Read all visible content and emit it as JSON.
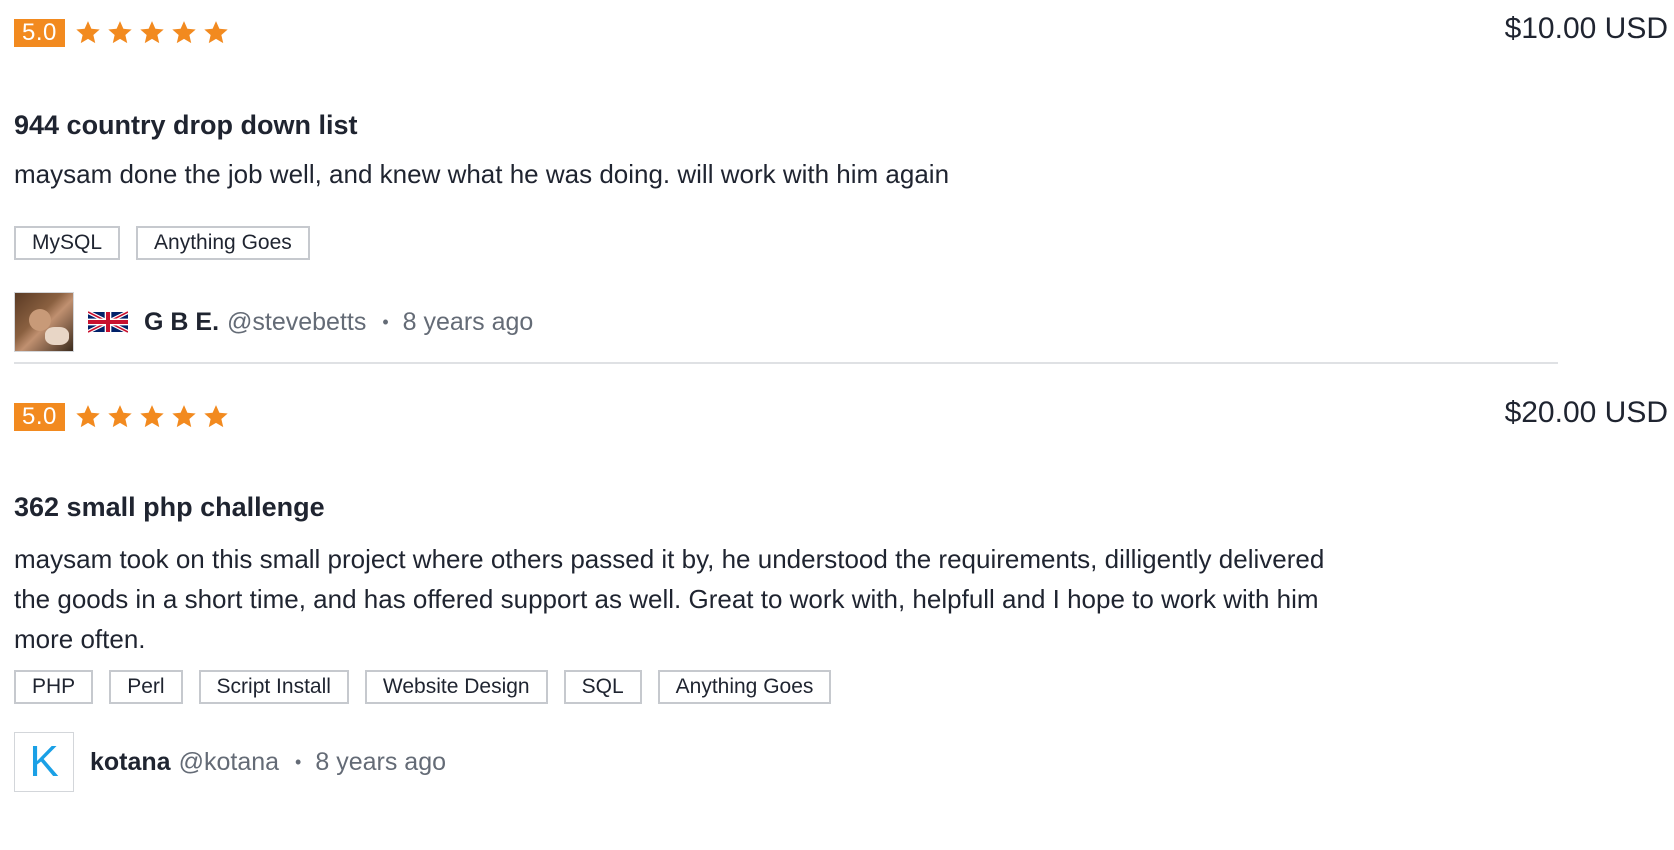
{
  "reviews": [
    {
      "rating": "5.0",
      "stars": 5,
      "price": "$10.00 USD",
      "title": "944 country drop down list",
      "text": "maysam done the job well, and knew what he was doing. will work with him again",
      "tags": [
        "MySQL",
        "Anything Goes"
      ],
      "author_name": "G B E.",
      "author_handle": "@stevebetts",
      "separator": "•",
      "time_ago": "8 years ago",
      "country_flag": "united-kingdom-flag-icon"
    },
    {
      "rating": "5.0",
      "stars": 5,
      "price": "$20.00 USD",
      "title": "362 small php challenge",
      "text": "maysam took on this small project where others passed it by, he understood the requirements, dilligently delivered the goods in a short time, and has offered support as well. Great to work with, helpfull and I hope to work with him more often.",
      "tags": [
        "PHP",
        "Perl",
        "Script Install",
        "Website Design",
        "SQL",
        "Anything Goes"
      ],
      "author_name": "kotana",
      "author_handle": "@kotana",
      "separator": "•",
      "time_ago": "8 years ago",
      "avatar_letter": "K"
    }
  ],
  "colors": {
    "rating_badge": "#f28a1f",
    "star": "#f28a1f",
    "avatar_letter": "#1aa0e6",
    "muted_text": "#646b76",
    "divider": "#dfe1e4"
  }
}
